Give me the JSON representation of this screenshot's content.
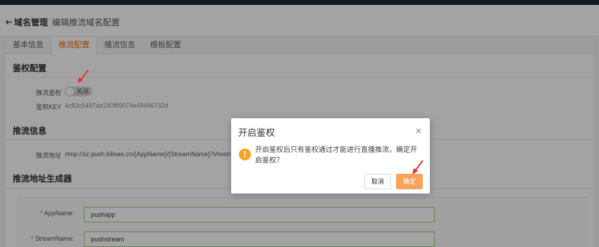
{
  "breadcrumb": {
    "back_label": "域名管理",
    "separator": "/",
    "current": "编辑推流域名配置"
  },
  "tabs": [
    {
      "label": "基本信息",
      "active": false
    },
    {
      "label": "推流配置",
      "active": true
    },
    {
      "label": "播流信息",
      "active": false
    },
    {
      "label": "模板配置",
      "active": false
    }
  ],
  "auth_section": {
    "title": "鉴权配置",
    "auth_label": "推流鉴权",
    "switch_text": "关闭",
    "switch_on": false,
    "key_label": "鉴权KEY",
    "key_value": "4c83c6497ae240f89074e49496732d"
  },
  "push_info": {
    "title": "推流信息",
    "address_label": "推流地址",
    "address_value": "rtmp://zz.push.kilines.cn/{AppName}/{StreamName}?vhost=zz.pus"
  },
  "generator": {
    "title": "推流地址生成器",
    "required_mark": "*",
    "app_name_label": "AppName:",
    "app_name_value": "pushapp",
    "stream_name_label": "StreamName:",
    "stream_name_value": "pushstream"
  },
  "modal": {
    "title": "开启鉴权",
    "message": "开启鉴权后只有鉴权通过才能进行直播推流，确定开启鉴权？",
    "cancel_label": "取消",
    "ok_label": "确定",
    "warning_glyph": "!"
  },
  "colors": {
    "accent": "#ff6a00",
    "ok_button": "#f7a35c",
    "warning": "#f5a623",
    "annotation_arrow": "#e8302a"
  }
}
